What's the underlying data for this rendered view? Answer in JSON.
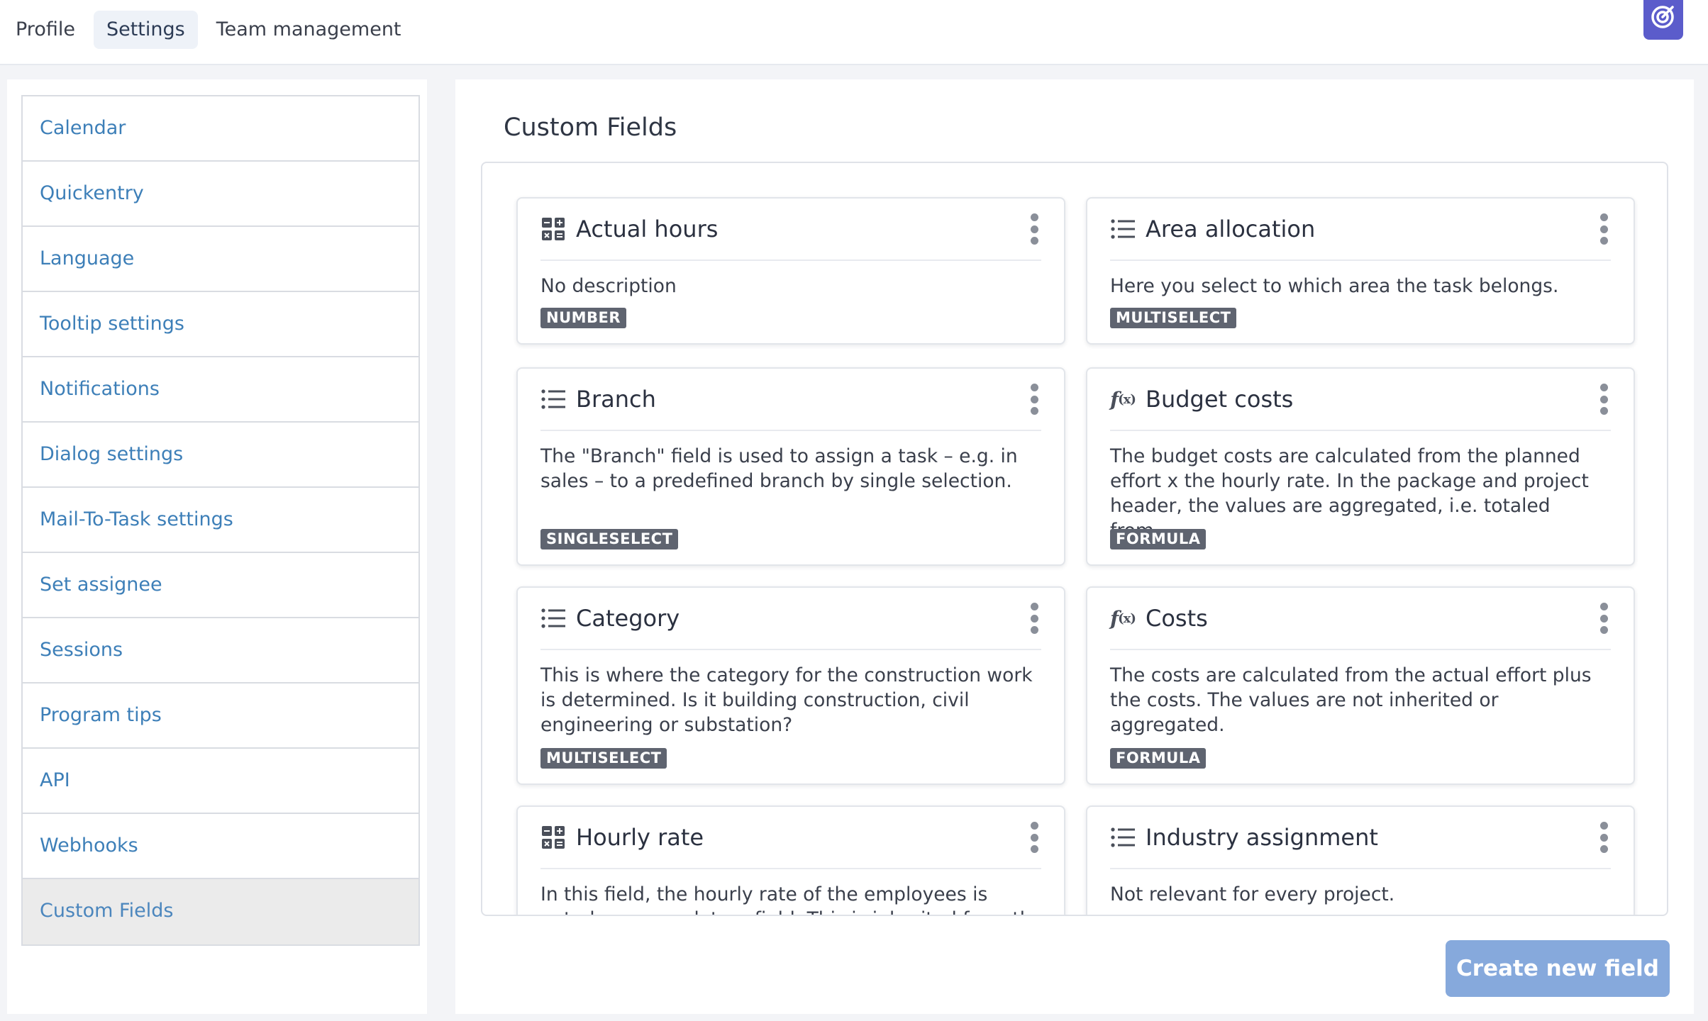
{
  "nav": {
    "tabs": [
      {
        "label": "Profile"
      },
      {
        "label": "Settings"
      },
      {
        "label": "Team management"
      }
    ]
  },
  "sidebar": {
    "items": [
      {
        "label": "Calendar"
      },
      {
        "label": "Quickentry"
      },
      {
        "label": "Language"
      },
      {
        "label": "Tooltip settings"
      },
      {
        "label": "Notifications"
      },
      {
        "label": "Dialog settings"
      },
      {
        "label": "Mail-To-Task settings"
      },
      {
        "label": "Set assignee"
      },
      {
        "label": "Sessions"
      },
      {
        "label": "Program tips"
      },
      {
        "label": "API"
      },
      {
        "label": "Webhooks"
      },
      {
        "label": "Custom Fields"
      }
    ],
    "selected": "Custom Fields"
  },
  "main": {
    "title": "Custom Fields",
    "fields": [
      {
        "title": "Actual hours",
        "icon": "number-grid-icon",
        "description": "No description",
        "type": "NUMBER"
      },
      {
        "title": "Area allocation",
        "icon": "list-icon",
        "description": "Here you select to which area the task belongs.",
        "type": "MULTISELECT"
      },
      {
        "title": "Branch",
        "icon": "list-icon",
        "description": "The \"Branch\" field is used to assign a task – e.g. in sales – to a predefined branch by single selection.",
        "type": "SINGLESELECT"
      },
      {
        "title": "Budget costs",
        "icon": "formula-icon",
        "description": "The budget costs are calculated from the planned effort x the hourly rate. In the package and project header, the values are aggregated, i.e. totaled from...",
        "type": "FORMULA"
      },
      {
        "title": "Category",
        "icon": "list-icon",
        "description": "This is where the category for the construction work is determined. Is it building construction, civil engineering or substation?",
        "type": "MULTISELECT"
      },
      {
        "title": "Costs",
        "icon": "formula-icon",
        "description": "The costs are calculated from the actual effort plus the costs. The values are not inherited or aggregated.",
        "type": "FORMULA"
      },
      {
        "title": "Hourly rate",
        "icon": "number-grid-icon",
        "description": "In this field, the hourly rate of the employees is noted as a mandatory field. This is inherited from the project",
        "type": ""
      },
      {
        "title": "Industry assignment",
        "icon": "list-icon",
        "description": "Not relevant for every project.",
        "type": ""
      }
    ],
    "create_button": "Create new field"
  },
  "colors": {
    "accent": "#5b5ccb",
    "link": "#3d7fb8",
    "button": "#86a9dc",
    "badge": "#5f6470"
  }
}
